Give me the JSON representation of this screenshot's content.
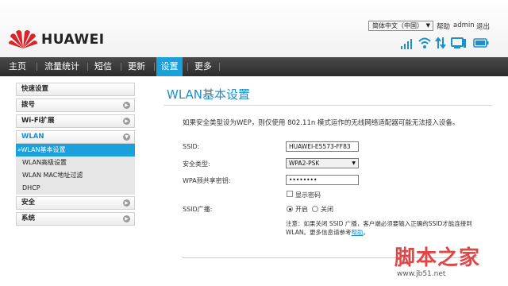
{
  "brand": {
    "name": "HUAWEI"
  },
  "header": {
    "language": "简体中文（中国）",
    "help": "帮助",
    "user": "admin",
    "logout": "退出",
    "status_icons": [
      "signal-strength-icon",
      "wifi-icon",
      "data-transfer-icon",
      "computer-icon",
      "battery-icon"
    ],
    "accent": "#1aa1dc"
  },
  "nav": {
    "items": [
      "主页",
      "流量统计",
      "短信",
      "更新",
      "设置",
      "更多"
    ],
    "active": "设置"
  },
  "sidebar": {
    "quick": "快速设置",
    "dial": "拨号",
    "wifi_ext": "Wi-Fi扩展",
    "wlan": "WLAN",
    "wlan_sub": [
      "WLAN基本设置",
      "WLAN高级设置",
      "WLAN MAC地址过滤",
      "DHCP"
    ],
    "security": "安全",
    "system": "系统"
  },
  "main": {
    "title": "WLAN基本设置",
    "notice": "如果安全类型设为WEP，则仅使用 802.11n 模式运作的无线网络适配器可能无法接入设备。",
    "ssid_label": "SSID:",
    "ssid_value": "HUAWEI-E5573-FF83",
    "security_label": "安全类型:",
    "security_value": "WPA2-PSK",
    "psk_label": "WPA预共享密钥:",
    "psk_value": "••••••••",
    "show_password": "显示密码",
    "broadcast_label": "SSID广播:",
    "on": "开启",
    "off": "关闭",
    "note_text": "注意：如果关闭 SSID 广播，客户端必须要输入正确的SSID才能连接到WLAN。更多信息请参考",
    "note_link": "帮助",
    "note_end": "。"
  },
  "watermark": {
    "big": "脚本之家",
    "small": "www.jb51.net"
  }
}
